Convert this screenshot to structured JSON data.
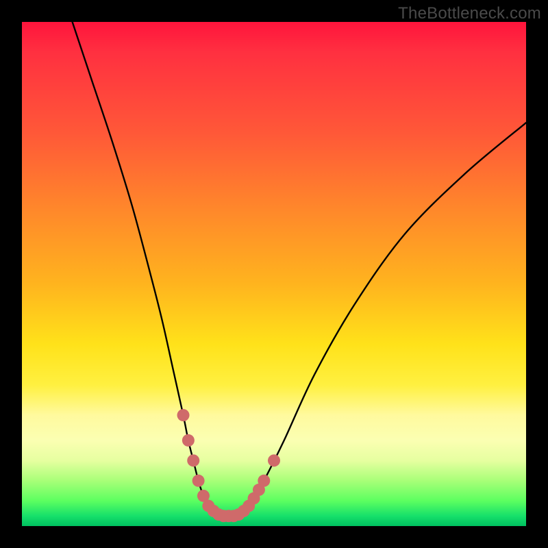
{
  "watermark": "TheBottleneck.com",
  "colors": {
    "background": "#000000",
    "curve_stroke": "#000000",
    "marker_fill": "#cf6a6a",
    "marker_stroke": "#b95555"
  },
  "chart_data": {
    "type": "line",
    "title": "",
    "xlabel": "",
    "ylabel": "",
    "xlim": [
      0,
      100
    ],
    "ylim": [
      0,
      100
    ],
    "grid": false,
    "legend": false,
    "series": [
      {
        "name": "bottleneck-curve",
        "x": [
          10,
          14,
          18,
          22,
          26,
          28,
          30,
          32,
          33,
          34,
          35,
          36,
          37,
          38,
          39,
          40,
          41,
          42,
          43,
          44,
          45,
          46,
          48,
          52,
          58,
          66,
          76,
          88,
          100
        ],
        "y": [
          100,
          88,
          76,
          63,
          48,
          40,
          31,
          22,
          17,
          13,
          9,
          6,
          4,
          3,
          2.3,
          2,
          2,
          2,
          2.3,
          3,
          4,
          5.5,
          9,
          17,
          30,
          44,
          58,
          70,
          80
        ]
      }
    ],
    "markers": {
      "name": "highlight-dots",
      "points": [
        {
          "x": 32.0,
          "y": 22
        },
        {
          "x": 33.0,
          "y": 17
        },
        {
          "x": 34.0,
          "y": 13
        },
        {
          "x": 35.0,
          "y": 9
        },
        {
          "x": 36.0,
          "y": 6
        },
        {
          "x": 37.0,
          "y": 4
        },
        {
          "x": 38.0,
          "y": 3
        },
        {
          "x": 39.0,
          "y": 2.3
        },
        {
          "x": 40.0,
          "y": 2
        },
        {
          "x": 41.0,
          "y": 2
        },
        {
          "x": 42.0,
          "y": 2
        },
        {
          "x": 43.0,
          "y": 2.3
        },
        {
          "x": 44.0,
          "y": 3
        },
        {
          "x": 45.0,
          "y": 4
        },
        {
          "x": 46.0,
          "y": 5.5
        },
        {
          "x": 47.0,
          "y": 7.2
        },
        {
          "x": 48.0,
          "y": 9
        },
        {
          "x": 50.0,
          "y": 13
        }
      ]
    }
  }
}
